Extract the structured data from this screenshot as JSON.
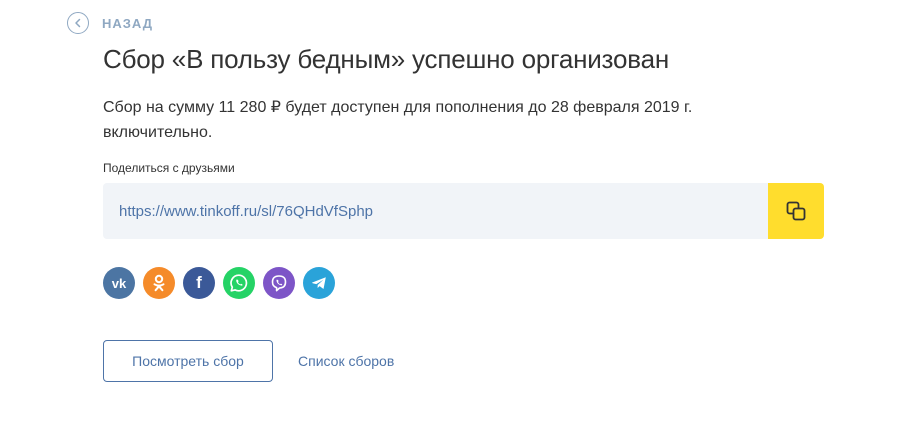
{
  "back": {
    "label": "НАЗАД"
  },
  "title": "Сбор «В пользу бедным» успешно организован",
  "description": "Сбор на сумму 11 280 ₽ будет доступен для пополнения до 28 февраля 2019 г. включительно.",
  "share": {
    "label": "Поделиться с друзьями",
    "url": "https://www.tinkoff.ru/sl/76QHdVfSphp",
    "copy_icon": "copy-icon"
  },
  "social": {
    "vk": "vk",
    "fb": "f",
    "icons": [
      "vk-icon",
      "odnoklassniki-icon",
      "facebook-icon",
      "whatsapp-icon",
      "viber-icon",
      "telegram-icon"
    ]
  },
  "actions": {
    "view_label": "Посмотреть сбор",
    "list_label": "Список сборов"
  },
  "colors": {
    "accent": "#ffdd2d",
    "link": "#4e74a8",
    "field_bg": "#f1f4f8",
    "vk": "#4c75a3",
    "odnoklassniki": "#f58b2a",
    "facebook": "#3b5998",
    "whatsapp": "#25d366",
    "viber": "#7d55c7",
    "telegram": "#2aa3d9"
  }
}
